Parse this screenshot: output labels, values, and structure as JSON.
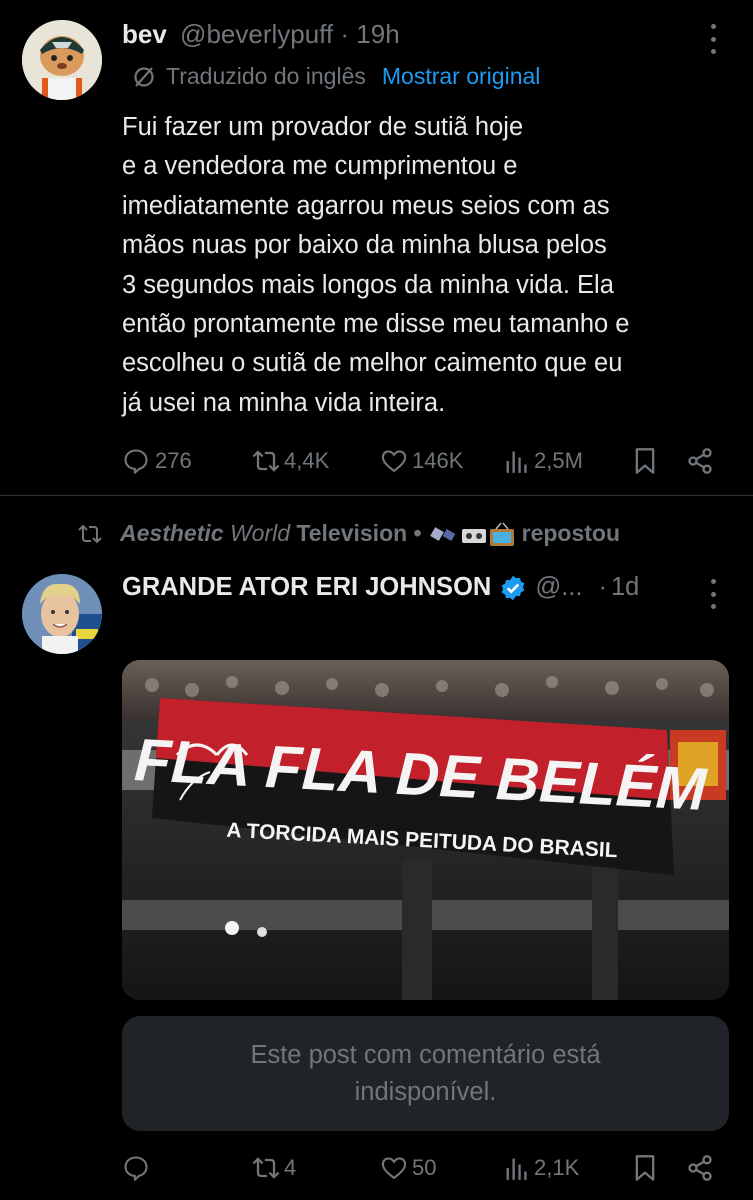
{
  "post1": {
    "display_name": "bev",
    "handle": "@beverlypuff",
    "separator": "·",
    "time": "19h",
    "translation_label": "Traduzido do inglês",
    "show_original": "Mostrar original",
    "body_lines": [
      "Fui fazer um provador de sutiã hoje",
      "e a vendedora me cumprimentou e",
      "imediatamente agarrou meus seios com as",
      "mãos nuas por baixo da minha blusa pelos",
      "3 segundos mais longos da minha vida. Ela",
      "então prontamente me disse meu tamanho e",
      "escolheu o sutiã de melhor caimento que eu",
      "já usei na minha vida inteira."
    ],
    "replies": "276",
    "reposts": "4,4K",
    "likes": "146K",
    "views": "2,5M"
  },
  "repost_banner": {
    "account_italic": "Aesthetic",
    "account_italic2": "World",
    "account_rest": "Television •",
    "suffix": "repostou"
  },
  "post2": {
    "display_name": "GRANDE ATOR ERI JOHNSON",
    "handle": "@...",
    "separator": "·",
    "time": "1d",
    "image_text_main": "FLA FLA DE BELÉM",
    "image_text_sub": "A TORCIDA MAIS PEITUDA DO BRASIL",
    "quote_unavailable_line1": "Este post com comentário está",
    "quote_unavailable_line2": "indisponível.",
    "replies": "",
    "reposts": "4",
    "likes": "50",
    "views": "2,1K"
  },
  "colors": {
    "background": "#000000",
    "text": "#e7e9ea",
    "muted": "#71767b",
    "link": "#1d9bf0",
    "verified": "#1d9bf0",
    "divider": "#2f3336",
    "quote_bg": "#202327"
  }
}
